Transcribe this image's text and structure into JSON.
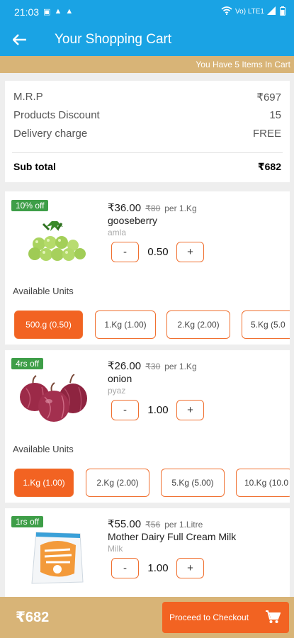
{
  "status": {
    "time": "21:03",
    "network": "Vo) LTE1"
  },
  "header": {
    "title": "Your Shopping Cart"
  },
  "items_bar": {
    "text": "You Have 5 Items In Cart"
  },
  "summary": {
    "mrp_label": "M.R.P",
    "mrp_value": "₹697",
    "discount_label": "Products Discount",
    "discount_value": "15",
    "delivery_label": "Delivery charge",
    "delivery_value": "FREE",
    "subtotal_label": "Sub total",
    "subtotal_value": "₹682"
  },
  "products": [
    {
      "badge": "10% off",
      "price": "₹36.00",
      "mrp": "₹80",
      "per": "per 1.Kg",
      "name": "gooseberry",
      "local_name": "amla",
      "qty": "0.50",
      "units_label": "Available Units",
      "units": [
        "500.g (0.50)",
        "1.Kg (1.00)",
        "2.Kg (2.00)",
        "5.Kg (5.0"
      ]
    },
    {
      "badge": "4rs off",
      "price": "₹26.00",
      "mrp": "₹30",
      "per": "per 1.Kg",
      "name": "onion",
      "local_name": "pyaz",
      "qty": "1.00",
      "units_label": "Available Units",
      "units": [
        "1.Kg (1.00)",
        "2.Kg (2.00)",
        "5.Kg (5.00)",
        "10.Kg (10.0"
      ]
    },
    {
      "badge": "1rs off",
      "price": "₹55.00",
      "mrp": "₹56",
      "per": "per 1.Litre",
      "name": "Mother Dairy Full Cream Milk",
      "local_name": "Milk",
      "qty": "1.00"
    }
  ],
  "stepper": {
    "minus": "-",
    "plus": "+"
  },
  "footer": {
    "total": "₹682",
    "checkout_label": "Proceed to Checkout"
  },
  "colors": {
    "primary": "#1aa3e4",
    "accent": "#f26322",
    "tan": "#d8b477",
    "badge": "#3e9e48"
  }
}
